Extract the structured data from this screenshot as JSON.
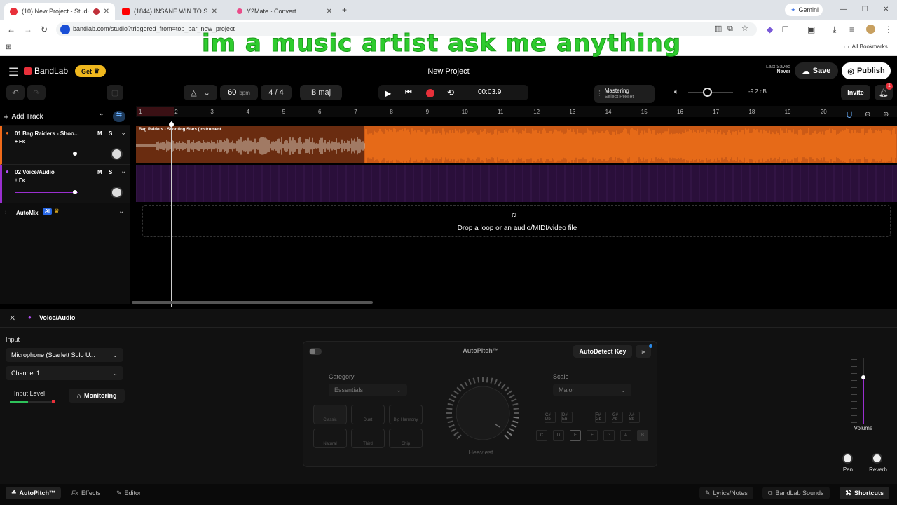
{
  "browser": {
    "tabs": [
      {
        "title": "(10) New Project - Studio",
        "color": "#e8303a"
      },
      {
        "title": "(1844) INSANE WIN TO START T",
        "color": "#ff0000"
      },
      {
        "title": "Y2Mate - Convert",
        "color": "#ea4c89"
      }
    ],
    "new_tab": "+",
    "gemini": "Gemini",
    "url": "bandlab.com/studio?triggered_from=top_bar_new_project",
    "all_bookmarks": "All Bookmarks"
  },
  "overlay_text": "im a music artist ask me anything",
  "header": {
    "logo": "BandLab",
    "get_label": "Get",
    "project_title": "New Project",
    "last_saved_label": "Last Saved",
    "last_saved_value": "Never",
    "save_label": "Save",
    "publish_label": "Publish"
  },
  "transport": {
    "tempo": "60",
    "tempo_unit": "bpm",
    "time_sig": "4 / 4",
    "key": "B maj",
    "time": "00:03.9",
    "mastering": "Mastering",
    "select_preset": "Select Preset",
    "volume_db": "-9.2 dB",
    "invite": "Invite",
    "notification_count": "1"
  },
  "tracks_toolbar": {
    "add_track": "Add Track"
  },
  "ruler": [
    "1",
    "2",
    "3",
    "4",
    "5",
    "6",
    "7",
    "8",
    "9",
    "10",
    "11",
    "12",
    "13",
    "14",
    "15",
    "16",
    "17",
    "18",
    "19",
    "20"
  ],
  "tracks": [
    {
      "name": "01  Bag Raiders - Shoo...",
      "fx": "+ Fx",
      "mute": "M",
      "solo": "S",
      "region": "Bag Raiders - Shooting Stars (Instrument",
      "color": "#f06a1a"
    },
    {
      "name": "02  Voice/Audio",
      "fx": "+ Fx",
      "mute": "M",
      "solo": "S",
      "color": "#9a2fd0"
    }
  ],
  "automix": {
    "label": "AutoMix",
    "badge": "AI"
  },
  "drop_zone": "Drop a loop or an audio/MIDI/video file",
  "panel": {
    "track_name": "Voice/Audio",
    "input_label": "Input",
    "input_device": "Microphone (Scarlett Solo U...",
    "channel": "Channel 1",
    "input_level": "Input Level",
    "monitoring": "Monitoring",
    "autopitch": {
      "title": "AutoPitch™",
      "autodetect": "AutoDetect Key",
      "category_label": "Category",
      "category_value": "Essentials",
      "scale_label": "Scale",
      "scale_value": "Major",
      "knob_label": "Heaviest",
      "presets": [
        "Classic",
        "Duet",
        "Big Harmony",
        "Natural",
        "Third",
        "Chip"
      ],
      "keys_top": [
        "C#\nDb",
        "D#\nEb",
        "F#\nGb",
        "G#\nAb",
        "A#\nBb"
      ],
      "keys_bottom": [
        "C",
        "D",
        "E",
        "F",
        "G",
        "A",
        "B"
      ]
    },
    "volume_label": "Volume",
    "pan_label": "Pan",
    "reverb_label": "Reverb"
  },
  "bottom_bar": {
    "autopitch": "AutoPitch™",
    "effects": "Effects",
    "editor": "Editor",
    "lyrics": "Lyrics/Notes",
    "sounds": "BandLab Sounds",
    "shortcuts": "Shortcuts"
  }
}
